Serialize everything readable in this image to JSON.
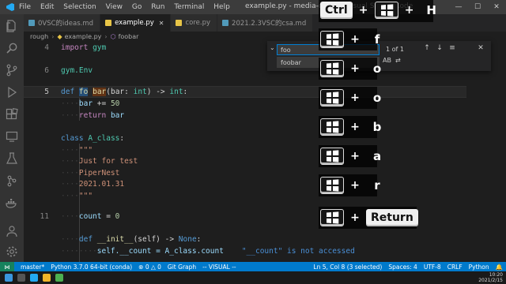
{
  "window": {
    "title": "example.py - media-drafts - Visual Studio Code",
    "menu": [
      "File",
      "Edit",
      "Selection",
      "View",
      "Go",
      "Run",
      "Terminal",
      "Help"
    ]
  },
  "tabs": [
    {
      "label": "0VSC的ideas.md",
      "color": "#519aba",
      "active": false
    },
    {
      "label": "example.py",
      "color": "#e8c547",
      "active": true
    },
    {
      "label": "core.py",
      "color": "#e8c547",
      "active": false
    },
    {
      "label": "2021.2.3VSC的csa.md",
      "color": "#519aba",
      "active": false
    }
  ],
  "breadcrumb": [
    "rough",
    "example.py",
    "foobar"
  ],
  "editor": {
    "line_numbers": [
      "4",
      "",
      "6",
      "",
      "5",
      "",
      "",
      "",
      "",
      "",
      "",
      "",
      "",
      "",
      "",
      "",
      "11",
      "",
      "",
      ""
    ],
    "current_line": "5",
    "find": {
      "value": "foo",
      "replace_value": "foobar",
      "count": "1 of 1",
      "toggles": [
        "Aa",
        "ab",
        ".*"
      ],
      "replace_toggle": "AB"
    },
    "code": {
      "l1_kw": "import",
      "l1_name": "gym",
      "l2": "gym.Env",
      "l3_def": "def",
      "l3_fn_a": "fo",
      "l3_fn_b": "bar",
      "l3_rest": "(bar: ",
      "l3_type": "int",
      "l3_arrow": ") -> ",
      "l3_ret": "int",
      "l3_colon": ":",
      "l4_var": "bar",
      "l4_op": " += ",
      "l4_num": "50",
      "l5_kw": "return",
      "l5_var": "bar",
      "l6_kw": "class",
      "l6_name": "A_class",
      "l6_colon": ":",
      "doc1": "\"\"\"",
      "doc2": "Just for test",
      "doc3": "PiperNest",
      "doc4": "2021.01.31",
      "doc5": "\"\"\"",
      "l7_var": "count",
      "l7_op": " = ",
      "l7_num": "0",
      "l8_def": "def",
      "l8_fn": "__init__",
      "l8_args": "(self)",
      "l8_arrow": " -> ",
      "l8_ret": "None",
      "l8_colon": ":",
      "l9_a": "self.__count = A_class.count",
      "l9_hint": "\"__count\" is not accessed"
    }
  },
  "shortcuts": [
    {
      "modifier": "Ctrl",
      "plus": "+",
      "key": "H"
    },
    {
      "plus": "+",
      "key": "f"
    },
    {
      "plus": "+",
      "key": "o"
    },
    {
      "plus": "+",
      "key": "o"
    },
    {
      "plus": "+",
      "key": "b"
    },
    {
      "plus": "+",
      "key": "a"
    },
    {
      "plus": "+",
      "key": "r"
    },
    {
      "plus": "+",
      "key": "Return"
    }
  ],
  "statusbar": {
    "branch": "master*",
    "interpreter": "Python 3.7.0 64-bit (conda)",
    "problems": "⊗ 0 △ 0",
    "git_graph": "Git Graph",
    "mode": "-- VISUAL --",
    "position": "Ln 5, Col 8 (3 selected)",
    "spaces": "Spaces: 4",
    "encoding": "UTF-8",
    "eol": "CRLF",
    "language": "Python"
  },
  "taskbar": {
    "time": "10:20",
    "date": "2021/2/15"
  }
}
